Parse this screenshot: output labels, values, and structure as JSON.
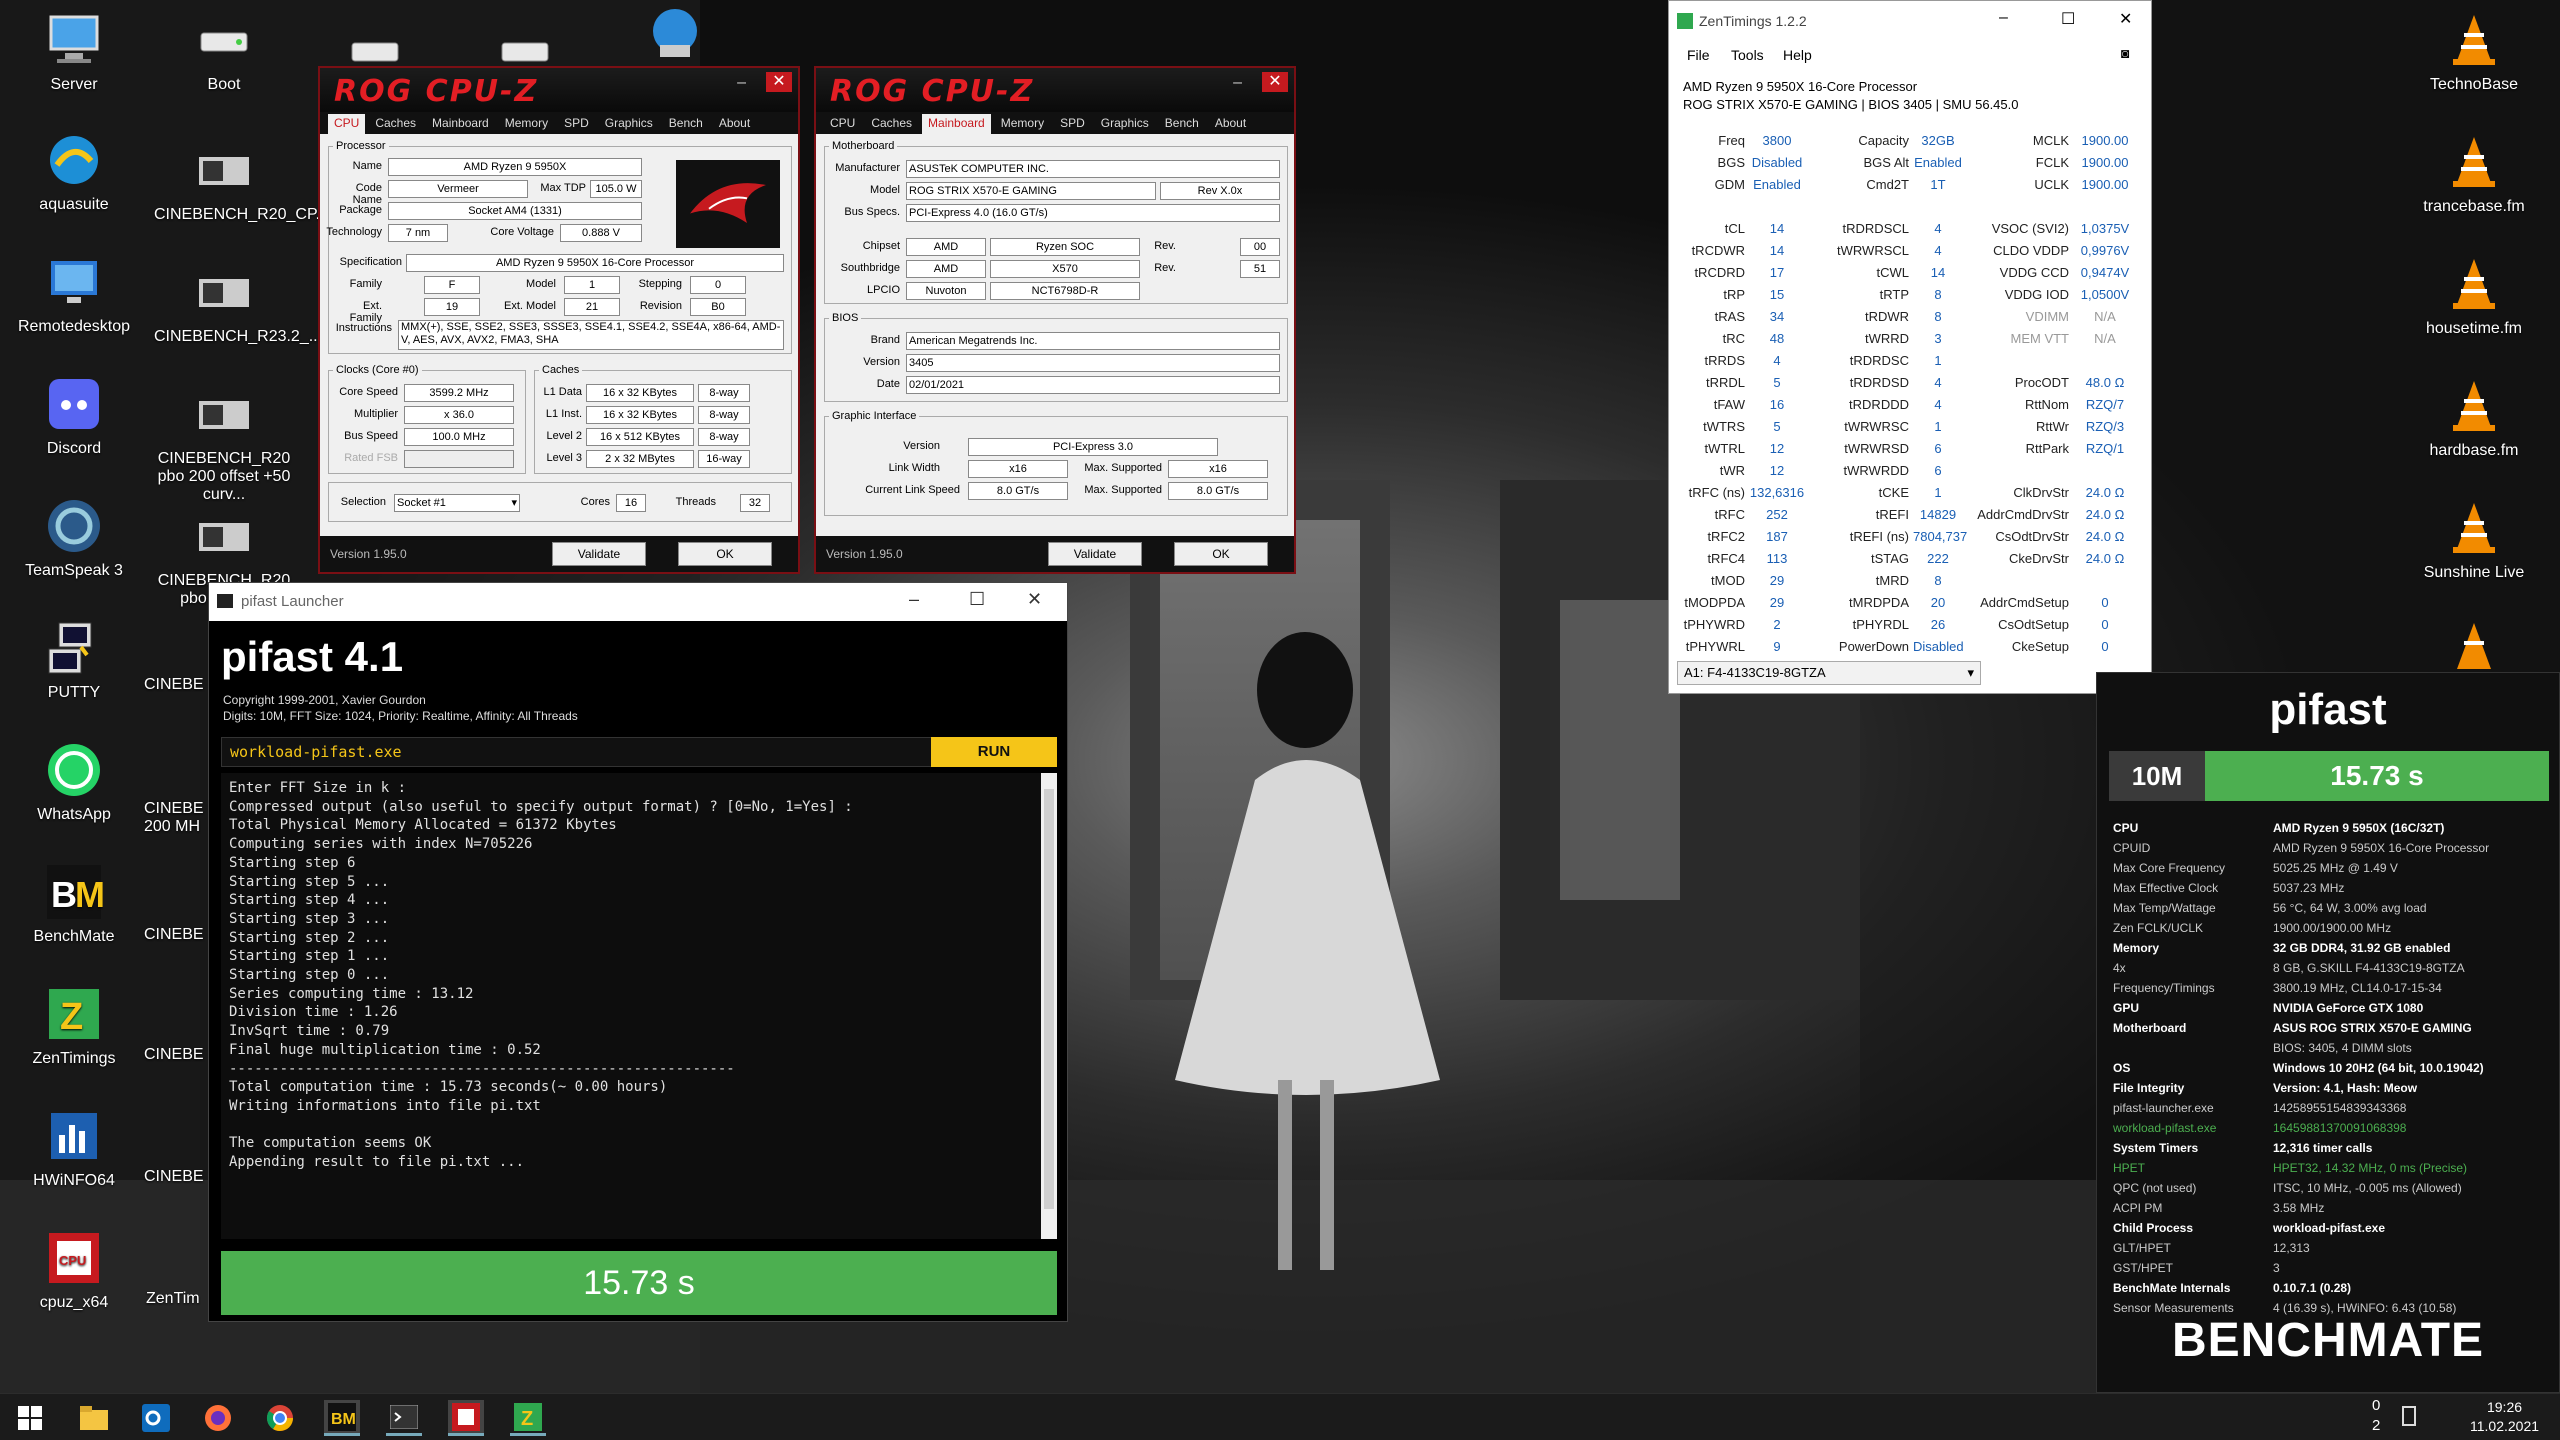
{
  "desktop_icons": [
    {
      "label": "Server",
      "icon": "computer-icon"
    },
    {
      "label": "aquasuite",
      "icon": "aquasuite-icon"
    },
    {
      "label": "Remotedesktop",
      "icon": "remote-desktop-icon"
    },
    {
      "label": "Discord",
      "icon": "discord-icon"
    },
    {
      "label": "TeamSpeak 3",
      "icon": "teamspeak-icon"
    },
    {
      "label": "PUTTY",
      "icon": "putty-icon"
    },
    {
      "label": "WhatsApp",
      "icon": "whatsapp-icon"
    },
    {
      "label": "BenchMate",
      "icon": "benchmate-icon"
    },
    {
      "label": "ZenTimings",
      "icon": "zentimings-icon"
    },
    {
      "label": "HWiNFO64",
      "icon": "hwinfo-icon"
    },
    {
      "label": "cpuz_x64",
      "icon": "cpuz-icon"
    },
    {
      "label": "Boot",
      "icon": "drive-icon"
    },
    {
      "label": "CINEBENCH_R20_CP...",
      "icon": "screenshot-icon"
    },
    {
      "label": "CINEBENCH_R23.2_...",
      "icon": "screenshot-icon"
    },
    {
      "label": "CINEBENCH_R20 pbo 200 offset +50 curv...",
      "icon": "screenshot-icon"
    },
    {
      "label": "CINEBENCH_R20 pbo 200 offs",
      "icon": "screenshot-icon"
    },
    {
      "label": "CINEBE",
      "icon": "screenshot-icon"
    },
    {
      "label": "CINEBE 200 MH",
      "icon": "screenshot-icon"
    },
    {
      "label": "CINEBE",
      "icon": "screenshot-icon"
    },
    {
      "label": "CINEBE",
      "icon": "screenshot-icon"
    },
    {
      "label": "CINEBE",
      "icon": "screenshot-icon"
    },
    {
      "label": "ZenTim",
      "icon": "screenshot-icon"
    },
    {
      "label": "TechnoBase",
      "icon": "vlc-icon"
    },
    {
      "label": "trancebase.fm",
      "icon": "vlc-icon"
    },
    {
      "label": "housetime.fm",
      "icon": "vlc-icon"
    },
    {
      "label": "hardbase.fm",
      "icon": "vlc-icon"
    },
    {
      "label": "Sunshine Live",
      "icon": "vlc-icon"
    }
  ],
  "cpuz1": {
    "logo": "ROG CPU-Z",
    "tabs": [
      "CPU",
      "Caches",
      "Mainboard",
      "Memory",
      "SPD",
      "Graphics",
      "Bench",
      "About"
    ],
    "processor_legend": "Processor",
    "name_label": "Name",
    "name": "AMD Ryzen 9 5950X",
    "codename_label": "Code Name",
    "codename": "Vermeer",
    "maxtdp_label": "Max TDP",
    "maxtdp": "105.0 W",
    "package_label": "Package",
    "package": "Socket AM4 (1331)",
    "tech_label": "Technology",
    "tech": "7 nm",
    "corevolt_label": "Core Voltage",
    "corevolt": "0.888 V",
    "spec_label": "Specification",
    "spec": "AMD Ryzen 9 5950X 16-Core Processor",
    "family_label": "Family",
    "family": "F",
    "model_label": "Model",
    "model": "1",
    "stepping_label": "Stepping",
    "stepping": "0",
    "extfamily_label": "Ext. Family",
    "extfamily": "19",
    "extmodel_label": "Ext. Model",
    "extmodel": "21",
    "revision_label": "Revision",
    "revision": "B0",
    "instr_label": "Instructions",
    "instr": "MMX(+), SSE, SSE2, SSE3, SSSE3, SSE4.1, SSE4.2, SSE4A, x86-64, AMD-V, AES, AVX, AVX2, FMA3, SHA",
    "clocks_legend": "Clocks (Core #0)",
    "corespeed_label": "Core Speed",
    "corespeed": "3599.2 MHz",
    "mult_label": "Multiplier",
    "mult": "x 36.0",
    "bus_label": "Bus Speed",
    "bus": "100.0 MHz",
    "fsb_label": "Rated FSB",
    "caches_legend": "Caches",
    "l1d_label": "L1 Data",
    "l1d": "16 x 32 KBytes",
    "l1d_way": "8-way",
    "l1i_label": "L1 Inst.",
    "l1i": "16 x 32 KBytes",
    "l1i_way": "8-way",
    "l2_label": "Level 2",
    "l2": "16 x 512 KBytes",
    "l2_way": "8-way",
    "l3_label": "Level 3",
    "l3": "2 x 32 MBytes",
    "l3_way": "16-way",
    "sel_label": "Selection",
    "sel": "Socket #1",
    "cores_label": "Cores",
    "cores": "16",
    "threads_label": "Threads",
    "threads": "32",
    "version": "Version 1.95.0",
    "validate": "Validate",
    "ok": "OK"
  },
  "cpuz2": {
    "logo": "ROG CPU-Z",
    "tabs": [
      "CPU",
      "Caches",
      "Mainboard",
      "Memory",
      "SPD",
      "Graphics",
      "Bench",
      "About"
    ],
    "mb_legend": "Motherboard",
    "manu_label": "Manufacturer",
    "manu": "ASUSTeK COMPUTER INC.",
    "model_label": "Model",
    "model": "ROG STRIX X570-E GAMING",
    "rev": "Rev X.0x",
    "busspec_label": "Bus Specs.",
    "busspec": "PCI-Express 4.0 (16.0 GT/s)",
    "chipset_label": "Chipset",
    "chipset_v": "AMD",
    "chipset_n": "Ryzen SOC",
    "chipset_rev_label": "Rev.",
    "chipset_rev": "00",
    "sb_label": "Southbridge",
    "sb_v": "AMD",
    "sb_n": "X570",
    "sb_rev_label": "Rev.",
    "sb_rev": "51",
    "lpcio_label": "LPCIO",
    "lpcio_v": "Nuvoton",
    "lpcio_n": "NCT6798D-R",
    "bios_legend": "BIOS",
    "brand_label": "Brand",
    "brand": "American Megatrends Inc.",
    "biosver_label": "Version",
    "biosver": "3405",
    "date_label": "Date",
    "date": "02/01/2021",
    "gi_legend": "Graphic Interface",
    "giver_label": "Version",
    "giver": "PCI-Express 3.0",
    "lw_label": "Link Width",
    "lw": "x16",
    "lwmax_label": "Max. Supported",
    "lwmax": "x16",
    "cls_label": "Current Link Speed",
    "cls": "8.0 GT/s",
    "clsmax_label": "Max. Supported",
    "clsmax": "8.0 GT/s",
    "version": "Version 1.95.0",
    "validate": "Validate",
    "ok": "OK"
  },
  "launcher": {
    "window_title": "pifast Launcher",
    "app_title": "pifast 4.1",
    "copyright": "Copyright 1999-2001, Xavier Gourdon",
    "params": "Digits: 10M, FFT Size: 1024, Priority: Realtime, Affinity: All Threads",
    "exe": "workload-pifast.exe",
    "run": "RUN",
    "console": [
      "Enter FFT Size in k :",
      "Compressed output (also useful to specify output format) ? [0=No, 1=Yes] :",
      "Total Physical Memory Allocated = 61372 Kbytes",
      "Computing series with index N=705226",
      "Starting step 6",
      "Starting step 5 ...",
      "Starting step 4 ...",
      "Starting step 3 ...",
      "Starting step 2 ...",
      "Starting step 1 ...",
      "Starting step 0 ...",
      "Series computing time : 13.12",
      "Division time : 1.26",
      "InvSqrt time : 0.79",
      "Final huge multiplication time : 0.52",
      "------------------------------------------------------------",
      "Total computation time : 15.73 seconds(~ 0.00 hours)",
      "Writing informations into file pi.txt",
      "",
      "The computation seems OK",
      "Appending result to file pi.txt ..."
    ],
    "result": "15.73 s"
  },
  "zen": {
    "title": "ZenTimings 1.2.2",
    "menu": [
      "File",
      "Tools",
      "Help"
    ],
    "cpu": "AMD Ryzen 9 5950X 16-Core Processor",
    "board": "ROG STRIX X570-E GAMING | BIOS 3405 | SMU 56.45.0",
    "col1": [
      [
        "Freq",
        "3800"
      ],
      [
        "BGS",
        "Disabled"
      ],
      [
        "GDM",
        "Enabled"
      ],
      [
        "",
        ""
      ],
      [
        "tCL",
        "14"
      ],
      [
        "tRCDWR",
        "14"
      ],
      [
        "tRCDRD",
        "17"
      ],
      [
        "tRP",
        "15"
      ],
      [
        "tRAS",
        "34"
      ],
      [
        "tRC",
        "48"
      ],
      [
        "tRRDS",
        "4"
      ],
      [
        "tRRDL",
        "5"
      ],
      [
        "tFAW",
        "16"
      ],
      [
        "tWTRS",
        "5"
      ],
      [
        "tWTRL",
        "12"
      ],
      [
        "tWR",
        "12"
      ],
      [
        "tRFC (ns)",
        "132,6316"
      ],
      [
        "tRFC",
        "252"
      ],
      [
        "tRFC2",
        "187"
      ],
      [
        "tRFC4",
        "113"
      ],
      [
        "tMOD",
        "29"
      ],
      [
        "tMODPDA",
        "29"
      ],
      [
        "tPHYWRD",
        "2"
      ],
      [
        "tPHYWRL",
        "9"
      ]
    ],
    "col2": [
      [
        "Capacity",
        "32GB"
      ],
      [
        "BGS Alt",
        "Enabled"
      ],
      [
        "Cmd2T",
        "1T"
      ],
      [
        "",
        ""
      ],
      [
        "tRDRDSCL",
        "4"
      ],
      [
        "tWRWRSCL",
        "4"
      ],
      [
        "tCWL",
        "14"
      ],
      [
        "tRTP",
        "8"
      ],
      [
        "tRDWR",
        "8"
      ],
      [
        "tWRRD",
        "3"
      ],
      [
        "tRDRDSC",
        "1"
      ],
      [
        "tRDRDSD",
        "4"
      ],
      [
        "tRDRDDD",
        "4"
      ],
      [
        "tWRWRSC",
        "1"
      ],
      [
        "tWRWRSD",
        "6"
      ],
      [
        "tWRWRDD",
        "6"
      ],
      [
        "tCKE",
        "1"
      ],
      [
        "tREFI",
        "14829"
      ],
      [
        "tREFI (ns)",
        "7804,737"
      ],
      [
        "tSTAG",
        "222"
      ],
      [
        "tMRD",
        "8"
      ],
      [
        "tMRDPDA",
        "20"
      ],
      [
        "tPHYRDL",
        "26"
      ],
      [
        "PowerDown",
        "Disabled"
      ]
    ],
    "col3": [
      [
        "MCLK",
        "1900.00"
      ],
      [
        "FCLK",
        "1900.00"
      ],
      [
        "UCLK",
        "1900.00"
      ],
      [
        "",
        ""
      ],
      [
        "VSOC (SVI2)",
        "1,0375V"
      ],
      [
        "CLDO VDDP",
        "0,9976V"
      ],
      [
        "VDDG CCD",
        "0,9474V"
      ],
      [
        "VDDG IOD",
        "1,0500V"
      ],
      [
        "VDIMM",
        "N/A"
      ],
      [
        "MEM VTT",
        "N/A"
      ],
      [
        "",
        ""
      ],
      [
        "ProcODT",
        "48.0 Ω"
      ],
      [
        "RttNom",
        "RZQ/7"
      ],
      [
        "RttWr",
        "RZQ/3"
      ],
      [
        "RttPark",
        "RZQ/1"
      ],
      [
        "",
        ""
      ],
      [
        "ClkDrvStr",
        "24.0 Ω"
      ],
      [
        "AddrCmdDrvStr",
        "24.0 Ω"
      ],
      [
        "CsOdtDrvStr",
        "24.0 Ω"
      ],
      [
        "CkeDrvStr",
        "24.0 Ω"
      ],
      [
        "",
        ""
      ],
      [
        "AddrCmdSetup",
        "0"
      ],
      [
        "CsOdtSetup",
        "0"
      ],
      [
        "CkeSetup",
        "0"
      ]
    ],
    "dimm": "A1: F4-4133C19-8GTZA"
  },
  "bm": {
    "title": "pifast",
    "digits": "10M",
    "result": "15.73 s",
    "rows": [
      [
        "CPU",
        "AMD Ryzen 9 5950X (16C/32T)",
        1
      ],
      [
        "CPUID",
        "AMD Ryzen 9 5950X 16-Core Processor",
        0
      ],
      [
        "Max Core Frequency",
        "5025.25 MHz @ 1.49 V",
        0
      ],
      [
        "Max Effective Clock",
        "5037.23 MHz",
        0
      ],
      [
        "Max Temp/Wattage",
        "56 °C, 64 W, 3.00% avg load",
        0
      ],
      [
        "Zen FCLK/UCLK",
        "1900.00/1900.00 MHz",
        0
      ],
      [
        "Memory",
        "32 GB DDR4, 31.92 GB enabled",
        1
      ],
      [
        "4x",
        "8 GB, G.SKILL F4-4133C19-8GTZA",
        0
      ],
      [
        "Frequency/Timings",
        "3800.19 MHz, CL14.0-17-15-34",
        0
      ],
      [
        "GPU",
        "NVIDIA GeForce GTX 1080",
        1
      ],
      [
        "Motherboard",
        "ASUS ROG STRIX X570-E GAMING",
        1
      ],
      [
        "",
        "BIOS: 3405, 4 DIMM slots",
        0
      ],
      [
        "OS",
        "Windows 10 20H2 (64 bit, 10.0.19042)",
        1
      ],
      [
        "File Integrity",
        "Version: 4.1, Hash: Meow",
        1
      ],
      [
        "pifast-launcher.exe",
        "14258955154839343368",
        0
      ],
      [
        "workload-pifast.exe",
        "16459881370091068398",
        2
      ],
      [
        "System Timers",
        "12,316 timer calls",
        1
      ],
      [
        "HPET",
        "HPET32, 14.32 MHz, 0 ms (Precise)",
        2
      ],
      [
        "QPC (not used)",
        "ITSC, 10 MHz, -0.005 ms (Allowed)",
        0
      ],
      [
        "ACPI PM",
        "3.58 MHz",
        0
      ],
      [
        "Child Process",
        "workload-pifast.exe",
        1
      ],
      [
        "GLT/HPET",
        "12,313",
        0
      ],
      [
        "GST/HPET",
        "3",
        0
      ],
      [
        "BenchMate Internals",
        "0.10.7.1 (0.28)",
        1
      ],
      [
        "Sensor Measurements",
        "4 (16.39 s), HWiNFO: 6.43 (10.58)",
        0
      ]
    ],
    "logo": "BENCHMATE"
  },
  "taskbar": {
    "time": "19:26",
    "date": "11.02.2021",
    "notif": "0",
    "notif2": "2"
  },
  "colors": {
    "green": "#4caf50",
    "rog_red": "#c61a1f",
    "accent_yellow": "#f5c518"
  }
}
